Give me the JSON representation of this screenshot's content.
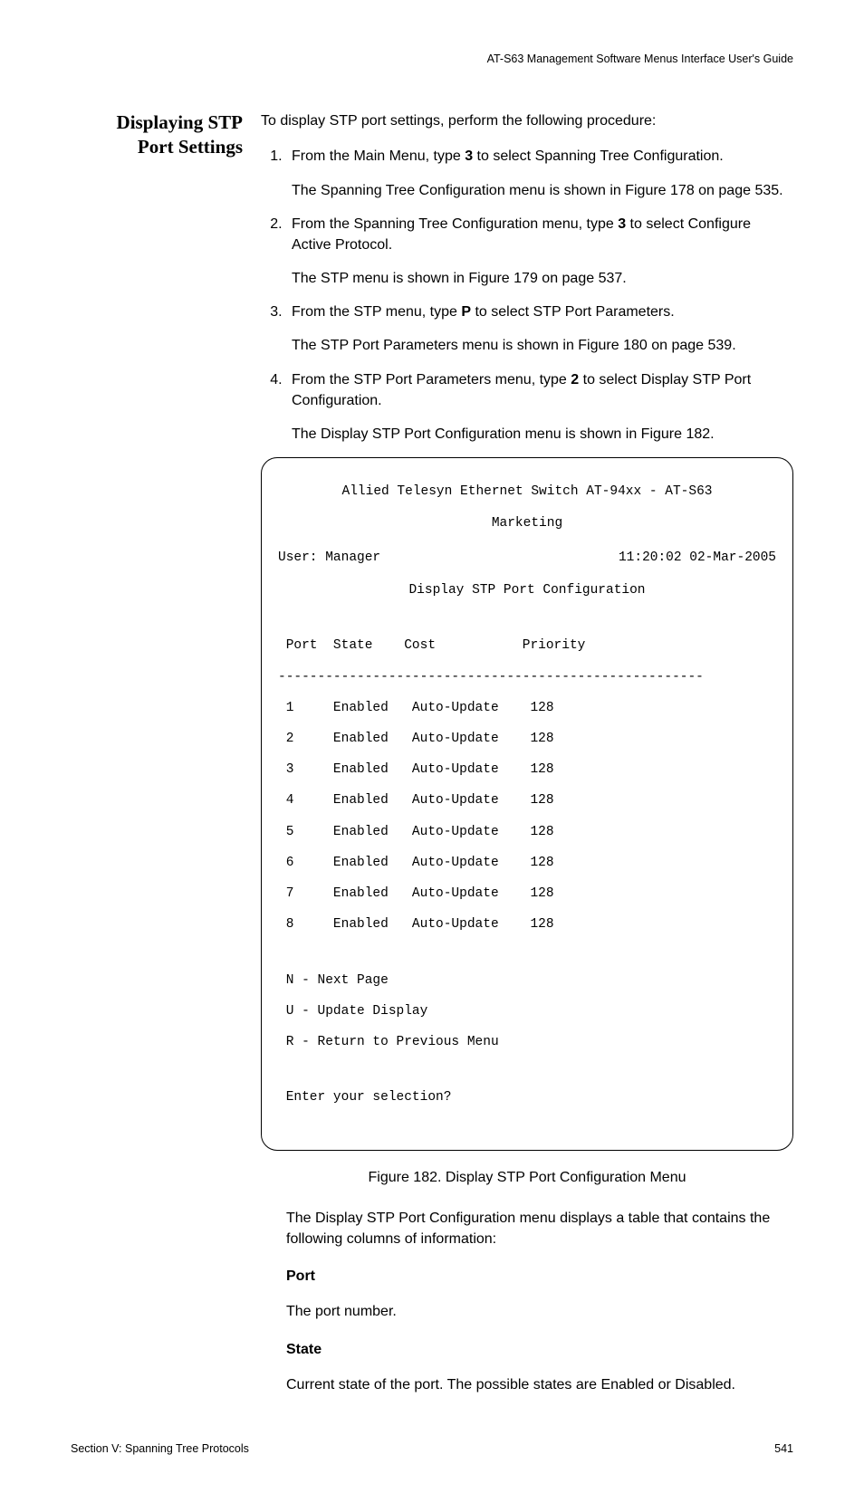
{
  "running_head": "AT-S63 Management Software Menus Interface User's Guide",
  "side_heading_l1": "Displaying STP",
  "side_heading_l2": "Port Settings",
  "intro": "To display STP port settings, perform the following procedure:",
  "steps": {
    "s1a": "From the Main Menu, type ",
    "s1b": "3",
    "s1c": " to select Spanning Tree Configuration.",
    "s1sub": "The Spanning Tree Configuration menu is shown in Figure 178 on page 535.",
    "s2a": "From the Spanning Tree Configuration menu, type ",
    "s2b": "3",
    "s2c": " to select Configure Active Protocol.",
    "s2sub": "The STP menu is shown in Figure 179 on page 537.",
    "s3a": "From the STP menu, type ",
    "s3b": "P",
    "s3c": " to select STP Port Parameters.",
    "s3sub": "The STP Port Parameters menu is shown in Figure 180 on page 539.",
    "s4a": "From the STP Port Parameters menu, type ",
    "s4b": "2",
    "s4c": " to select Display STP Port Configuration.",
    "s4sub": "The Display STP Port Configuration menu is shown in Figure 182."
  },
  "terminal": {
    "hdr1": "Allied Telesyn Ethernet Switch AT-94xx - AT-S63",
    "hdr2": "Marketing",
    "user_label": "User: Manager",
    "timestamp": "11:20:02 02-Mar-2005",
    "title": "Display STP Port Configuration",
    "columns": " Port  State    Cost           Priority",
    "divider": "------------------------------------------------------",
    "rows": [
      " 1     Enabled   Auto-Update    128",
      " 2     Enabled   Auto-Update    128",
      " 3     Enabled   Auto-Update    128",
      " 4     Enabled   Auto-Update    128",
      " 5     Enabled   Auto-Update    128",
      " 6     Enabled   Auto-Update    128",
      " 7     Enabled   Auto-Update    128",
      " 8     Enabled   Auto-Update    128"
    ],
    "menu": [
      " N - Next Page",
      " U - Update Display",
      " R - Return to Previous Menu"
    ],
    "prompt": " Enter your selection?"
  },
  "fig_caption": "Figure 182. Display STP Port Configuration Menu",
  "after_fig": "The Display STP Port Configuration menu displays a table that contains the following columns of information:",
  "defs": {
    "port_label": "Port",
    "port_desc": "The port number.",
    "state_label": "State",
    "state_desc": "Current state of the port. The possible states are Enabled or Disabled."
  },
  "footer_left": "Section V: Spanning Tree Protocols",
  "footer_right": "541",
  "chart_data": {
    "type": "table",
    "title": "Display STP Port Configuration",
    "columns": [
      "Port",
      "State",
      "Cost",
      "Priority"
    ],
    "rows": [
      {
        "Port": 1,
        "State": "Enabled",
        "Cost": "Auto-Update",
        "Priority": 128
      },
      {
        "Port": 2,
        "State": "Enabled",
        "Cost": "Auto-Update",
        "Priority": 128
      },
      {
        "Port": 3,
        "State": "Enabled",
        "Cost": "Auto-Update",
        "Priority": 128
      },
      {
        "Port": 4,
        "State": "Enabled",
        "Cost": "Auto-Update",
        "Priority": 128
      },
      {
        "Port": 5,
        "State": "Enabled",
        "Cost": "Auto-Update",
        "Priority": 128
      },
      {
        "Port": 6,
        "State": "Enabled",
        "Cost": "Auto-Update",
        "Priority": 128
      },
      {
        "Port": 7,
        "State": "Enabled",
        "Cost": "Auto-Update",
        "Priority": 128
      },
      {
        "Port": 8,
        "State": "Enabled",
        "Cost": "Auto-Update",
        "Priority": 128
      }
    ],
    "menu_options": [
      "N - Next Page",
      "U - Update Display",
      "R - Return to Previous Menu"
    ]
  }
}
